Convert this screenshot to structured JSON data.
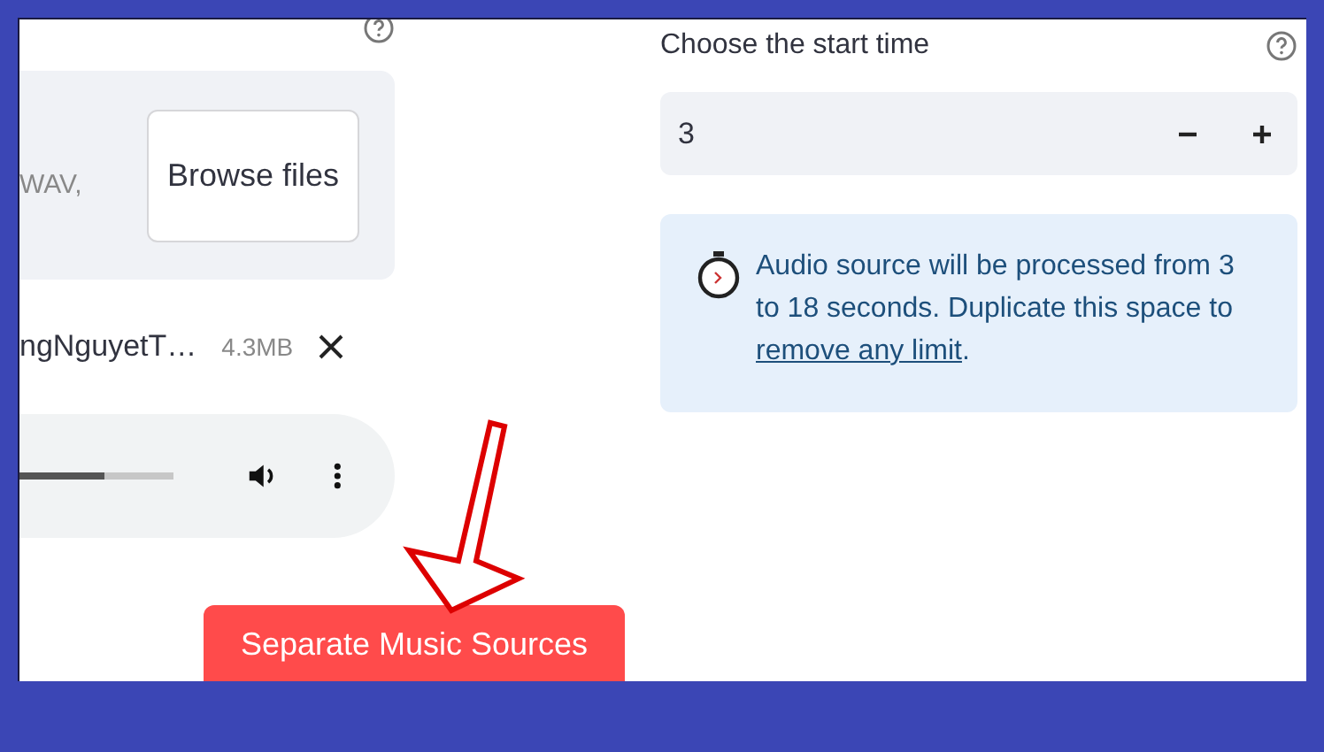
{
  "uploader": {
    "format_hint": "WAV,",
    "browse_button": "Browse files"
  },
  "file": {
    "name": "ngNguyetT…",
    "size": "4.3MB"
  },
  "player": {
    "level": 0.55
  },
  "start_time": {
    "label": "Choose the start time",
    "value": "3"
  },
  "info": {
    "text": "Audio source will be processed from 3 to 18 seconds. Duplicate this space to ",
    "link": "remove any limit",
    "after": "."
  },
  "submit_button": "Separate Music Sources"
}
